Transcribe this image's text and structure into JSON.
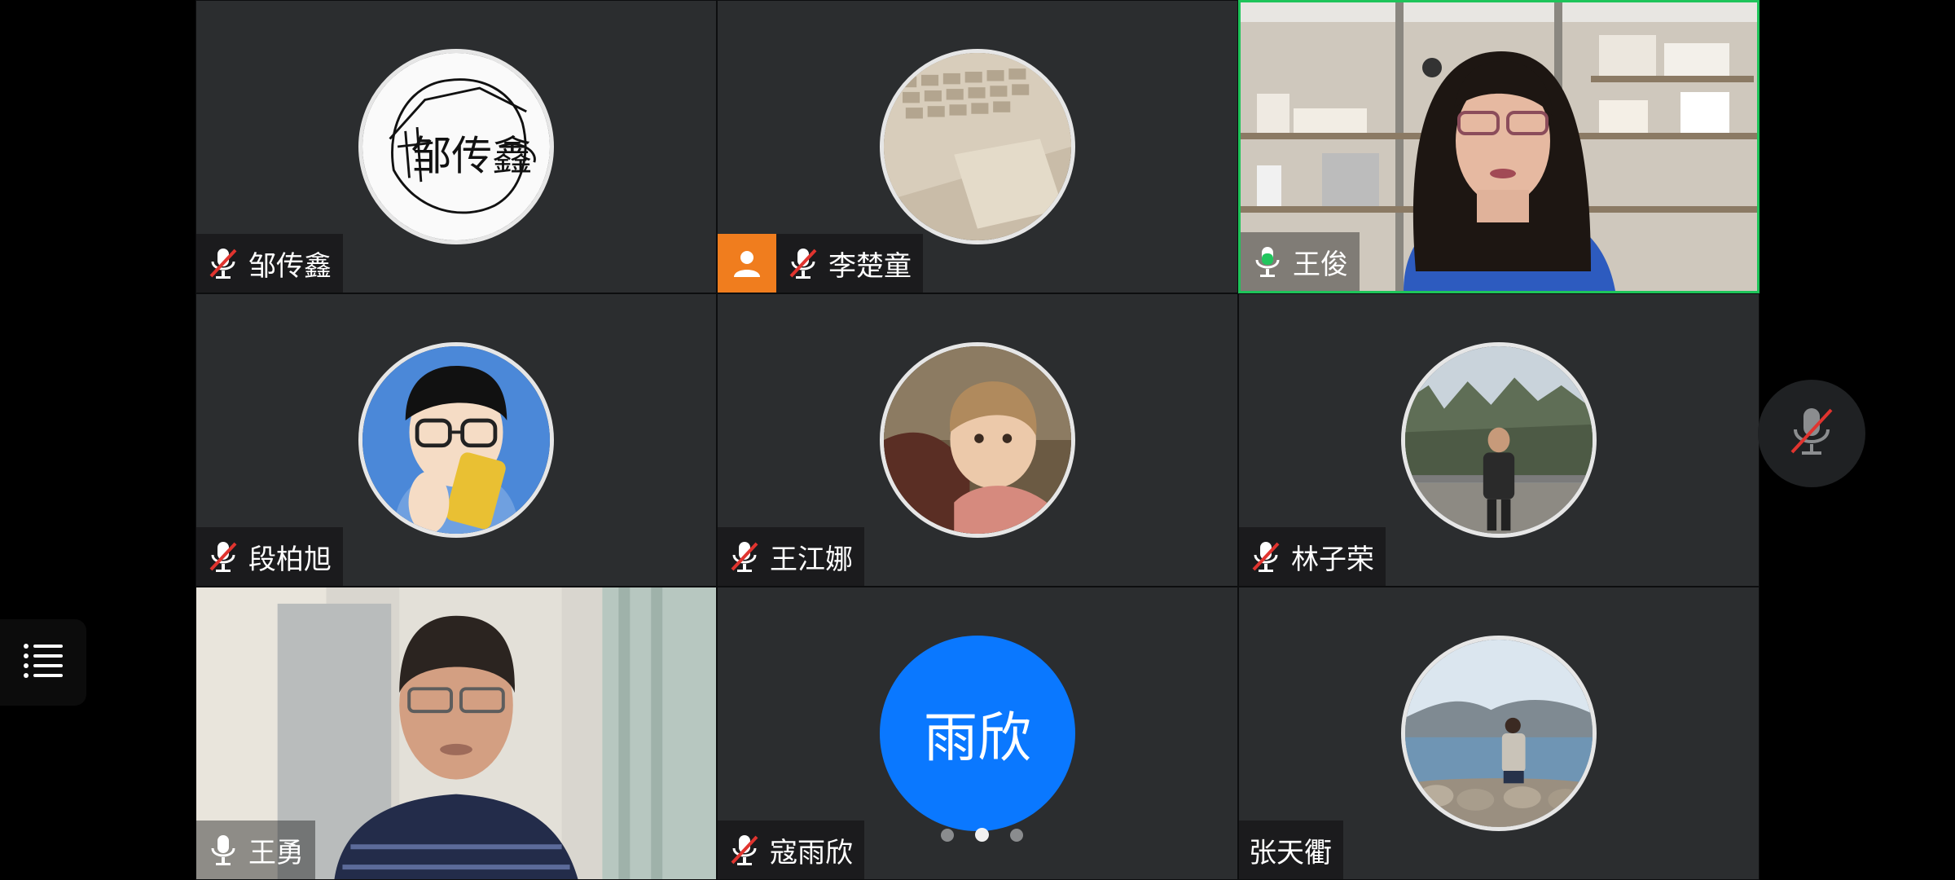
{
  "participants": [
    {
      "name": "邹传鑫",
      "mic": "muted",
      "avatar": "doodle-avatar"
    },
    {
      "name": "李楚童",
      "mic": "muted",
      "avatar": "laptop-photo-avatar",
      "badge": "person-icon"
    },
    {
      "name": "王俊",
      "mic": "speaking",
      "avatar": "live-video",
      "active": true
    },
    {
      "name": "段柏旭",
      "mic": "muted",
      "avatar": "cartoon-glasses-avatar"
    },
    {
      "name": "王江娜",
      "mic": "muted",
      "avatar": "child-photo-avatar"
    },
    {
      "name": "林子荣",
      "mic": "muted",
      "avatar": "mountain-photo-avatar"
    },
    {
      "name": "王勇",
      "mic": "on",
      "avatar": "live-video"
    },
    {
      "name": "寇雨欣",
      "mic": "muted",
      "avatar": "initials-avatar",
      "initials": "雨欣"
    },
    {
      "name": "张天衢",
      "mic": "none",
      "avatar": "lake-photo-avatar"
    }
  ],
  "pagination": {
    "total": 3,
    "current": 2
  },
  "colors": {
    "tile_bg": "#2b2d2f",
    "active_border": "#1ec45a",
    "initials_bg": "#0a78ff",
    "badge": "#f07d1e",
    "mute_slash": "#e0342f"
  }
}
